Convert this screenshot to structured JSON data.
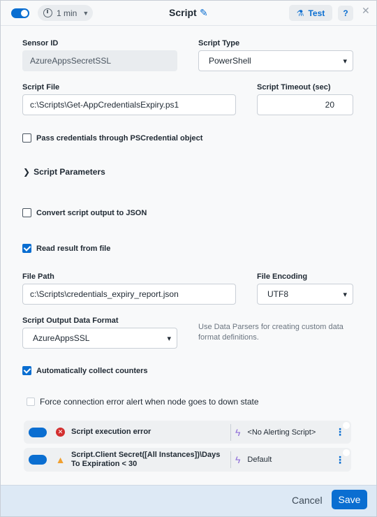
{
  "header": {
    "title": "Script",
    "interval": "1 min",
    "test_label": "Test",
    "help_label": "?",
    "close_label": "✕"
  },
  "form": {
    "sensor_id_label": "Sensor ID",
    "sensor_id_value": "AzureAppsSecretSSL",
    "script_type_label": "Script Type",
    "script_type_value": "PowerShell",
    "script_file_label": "Script File",
    "script_file_value": "c:\\Scripts\\Get-AppCredentialsExpiry.ps1",
    "script_timeout_label": "Script Timeout (sec)",
    "script_timeout_value": "20",
    "pass_credentials_label": "Pass credentials through PSCredential object",
    "script_parameters_label": "Script Parameters",
    "convert_json_label": "Convert script output to JSON",
    "read_result_label": "Read result from file",
    "file_path_label": "File Path",
    "file_path_value": "c:\\Scripts\\credentials_expiry_report.json",
    "file_encoding_label": "File Encoding",
    "file_encoding_value": "UTF8",
    "output_format_label": "Script Output Data Format",
    "output_format_value": "AzureAppsSSL",
    "output_format_hint": "Use Data Parsers for creating custom data format definitions.",
    "auto_collect_label": "Automatically collect counters",
    "force_alert_label": "Force connection error alert when node goes to down state"
  },
  "alerts": [
    {
      "name": "Script execution error",
      "script": "<No Alerting Script>",
      "severity": "error"
    },
    {
      "name": "Script.Client Secret([All Instances])\\Days To Expiration < 30",
      "script": "Default",
      "severity": "warning"
    }
  ],
  "footer": {
    "cancel_label": "Cancel",
    "save_label": "Save"
  },
  "colors": {
    "accent": "#0a6ed1",
    "error": "#d32f2f",
    "warning": "#f0a030",
    "footer_bg": "#dde9f5"
  }
}
